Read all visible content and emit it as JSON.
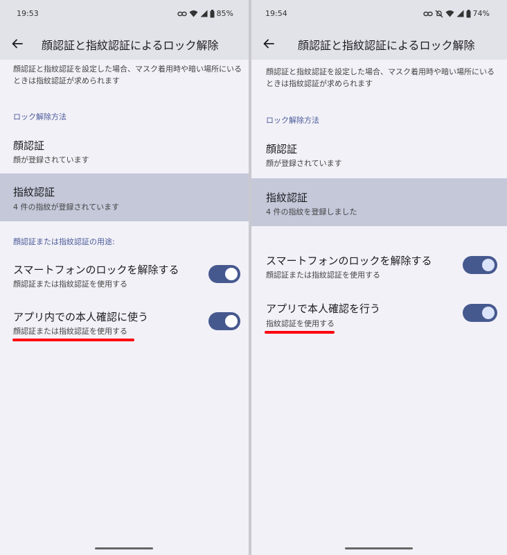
{
  "left": {
    "status": {
      "time": "19:53",
      "battery": "85%"
    },
    "header": {
      "title": "顔認証と指紋認証によるロック解除"
    },
    "description": "顔認証と指紋認証を設定した場合、マスク着用時や暗い場所にいるときは指紋認証が求められます",
    "unlock_section": "ロック解除方法",
    "face": {
      "title": "顔認証",
      "subtitle": "顔が登録されています"
    },
    "fingerprint": {
      "title": "指紋認証",
      "subtitle": "4 件の指紋が登録されています"
    },
    "usage_section": "顔認証または指紋認証の用途:",
    "phone_unlock": {
      "title": "スマートフォンのロックを解除する",
      "subtitle": "顔認証または指紋認証を使用する",
      "enabled": true
    },
    "app_auth": {
      "title": "アプリ内での本人確認に使う",
      "subtitle": "顔認証または指紋認証を使用する",
      "enabled": true
    }
  },
  "right": {
    "status": {
      "time": "19:54",
      "battery": "74%"
    },
    "header": {
      "title": "顔認証と指紋認証によるロック解除"
    },
    "description": "顔認証と指紋認証を設定した場合、マスク着用時や暗い場所にいるときは指紋認証が求められます",
    "unlock_section": "ロック解除方法",
    "face": {
      "title": "顔認証",
      "subtitle": "顔が登録されています"
    },
    "fingerprint": {
      "title": "指紋認証",
      "subtitle": "4 件の指紋を登録しました"
    },
    "phone_unlock": {
      "title": "スマートフォンのロックを解除する",
      "subtitle": "顔認証または指紋認証を使用する",
      "enabled": true
    },
    "app_auth": {
      "title": "アプリで本人確認を行う",
      "subtitle": "指紋認証を使用する",
      "enabled": true
    }
  },
  "colors": {
    "background": "#f2f1f7",
    "appbar": "#e2e2e9",
    "highlight": "#c4c8d9",
    "toggle_on": "#46598f",
    "accent_text": "#4a5a9a",
    "annotation": "#ff0010"
  },
  "icons": [
    "back-arrow-icon",
    "link-icon",
    "mute-icon",
    "wifi-icon",
    "signal-icon",
    "battery-icon"
  ]
}
